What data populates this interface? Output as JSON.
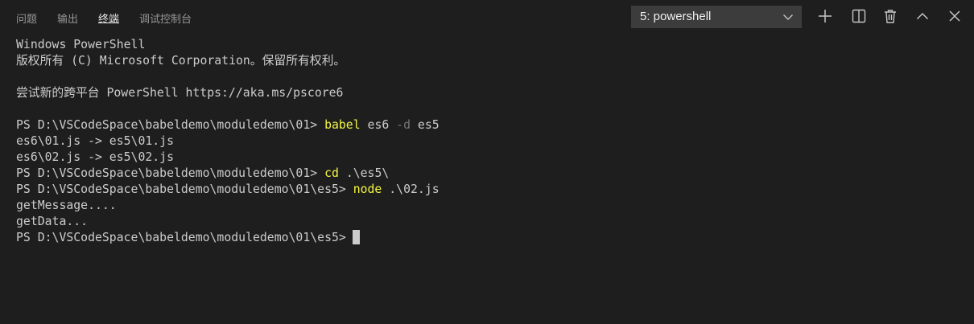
{
  "tabs": [
    {
      "label": "问题",
      "active": false
    },
    {
      "label": "输出",
      "active": false
    },
    {
      "label": "终端",
      "active": true
    },
    {
      "label": "调试控制台",
      "active": false
    }
  ],
  "terminal_selector": {
    "value": "5: powershell"
  },
  "actions": [
    {
      "icon": "plus-icon",
      "title": "new-terminal"
    },
    {
      "icon": "split-icon",
      "title": "split-terminal"
    },
    {
      "icon": "trash-icon",
      "title": "kill-terminal"
    },
    {
      "icon": "chevron-up-icon",
      "title": "maximize-panel"
    },
    {
      "icon": "close-icon",
      "title": "close-panel"
    }
  ],
  "colors": {
    "background": "#1e1e1e",
    "text": "#cccccc",
    "command": "#f5f543",
    "parameter": "#767676",
    "select_background": "#3c3c3c"
  },
  "terminal": {
    "line1": "Windows PowerShell",
    "line2": "版权所有 (C) Microsoft Corporation。保留所有权利。",
    "line3": "",
    "line4": "尝试新的跨平台 PowerShell https://aka.ms/pscore6",
    "line5": "",
    "line6": {
      "prompt": "PS D:\\VSCodeSpace\\babeldemo\\moduledemo\\01> ",
      "command": "babel",
      "arg1": " es6 ",
      "param": "-d",
      "arg2": " es5"
    },
    "line7": "es6\\01.js -> es5\\01.js",
    "line8": "es6\\02.js -> es5\\02.js",
    "line9": {
      "prompt": "PS D:\\VSCodeSpace\\babeldemo\\moduledemo\\01> ",
      "command": "cd",
      "args": " .\\es5\\"
    },
    "line10": {
      "prompt": "PS D:\\VSCodeSpace\\babeldemo\\moduledemo\\01\\es5> ",
      "command": "node",
      "args": " .\\02.js"
    },
    "line11": "getMessage....",
    "line12": "getData...",
    "line13": {
      "prompt": "PS D:\\VSCodeSpace\\babeldemo\\moduledemo\\01\\es5>"
    }
  }
}
